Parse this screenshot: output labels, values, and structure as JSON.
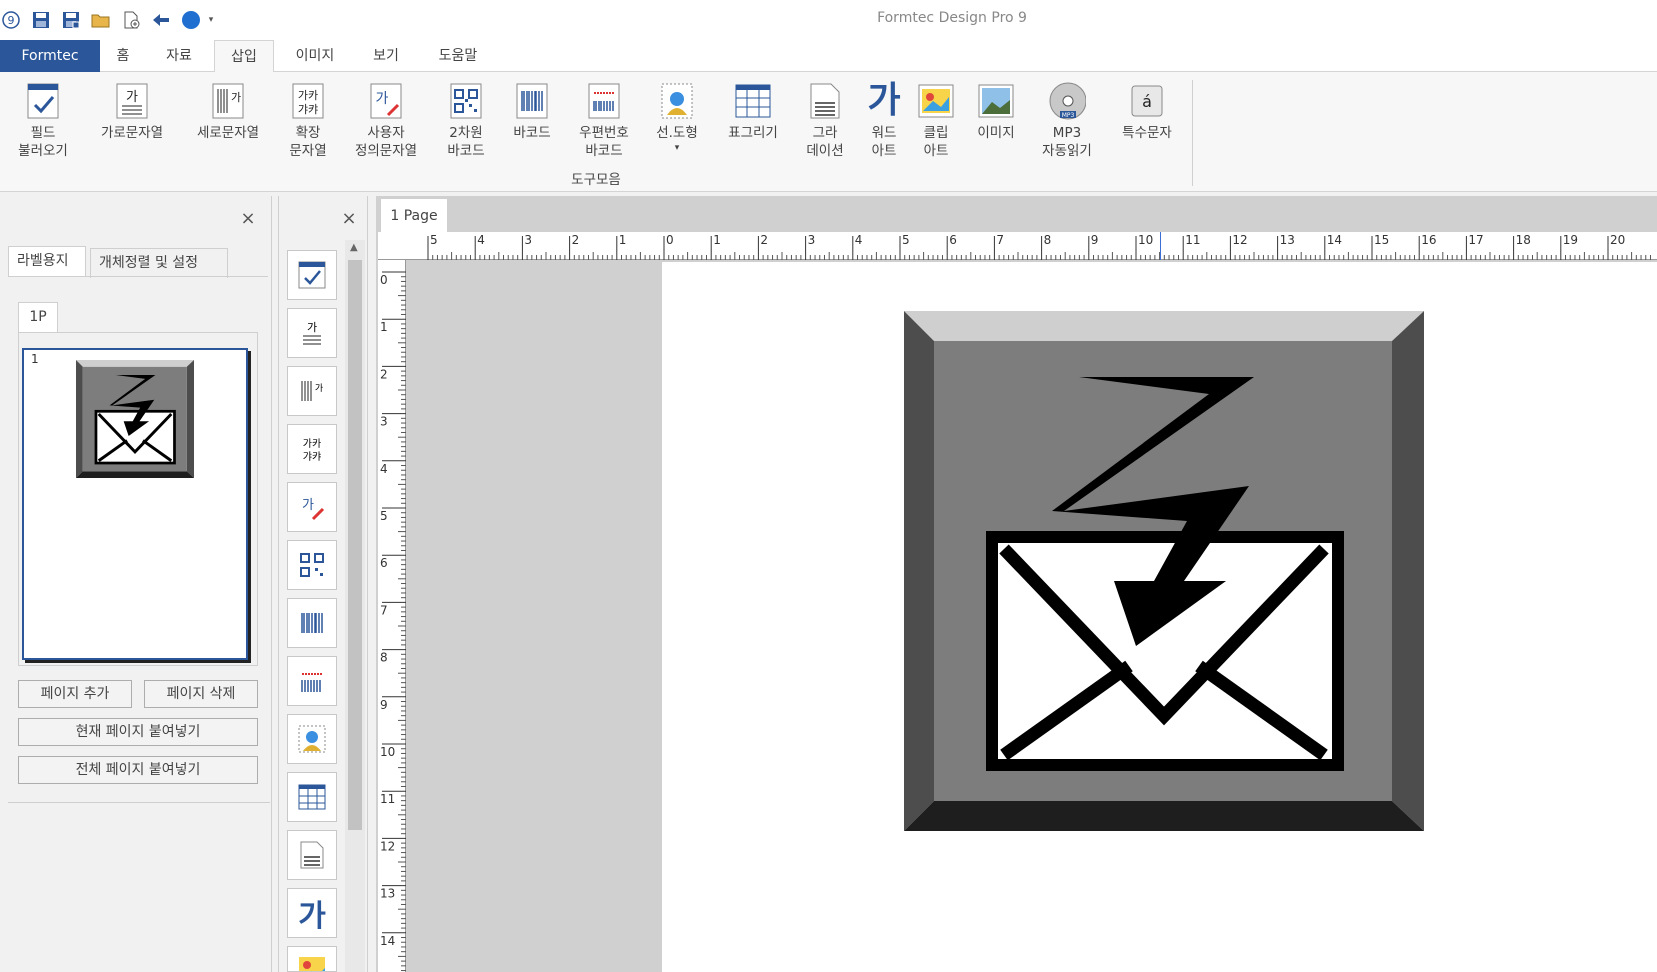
{
  "window": {
    "title": "Formtec Design Pro 9"
  },
  "menu": {
    "file_label": "Formtec",
    "tabs": [
      "홈",
      "자료",
      "삽입",
      "이미지",
      "보기",
      "도움말"
    ],
    "active_tab": "삽입"
  },
  "ribbon": {
    "items": [
      {
        "line1": "필드",
        "line2": "불러오기",
        "icon": "field-load-icon"
      },
      {
        "line1": "가로문자열",
        "line2": "",
        "icon": "horizontal-text-icon"
      },
      {
        "line1": "세로문자열",
        "line2": "",
        "icon": "vertical-text-icon"
      },
      {
        "line1": "확장",
        "line2": "문자열",
        "icon": "extended-text-icon"
      },
      {
        "line1": "사용자",
        "line2": "정의문자열",
        "icon": "custom-text-icon"
      },
      {
        "line1": "2차원",
        "line2": "바코드",
        "icon": "qr-code-icon"
      },
      {
        "line1": "바코드",
        "line2": "",
        "icon": "barcode-icon"
      },
      {
        "line1": "우편번호",
        "line2": "바코드",
        "icon": "postal-barcode-icon"
      },
      {
        "line1": "선.도형",
        "line2": "▾",
        "icon": "shape-icon"
      },
      {
        "line1": "표그리기",
        "line2": "",
        "icon": "table-icon"
      },
      {
        "line1": "그라",
        "line2": "데이션",
        "icon": "gradation-icon"
      },
      {
        "line1": "워드",
        "line2": "아트",
        "icon": "wordart-icon"
      },
      {
        "line1": "클립",
        "line2": "아트",
        "icon": "clipart-icon"
      },
      {
        "line1": "이미지",
        "line2": "",
        "icon": "image-icon"
      },
      {
        "line1": "MP3",
        "line2": "자동읽기",
        "icon": "mp3-icon"
      },
      {
        "line1": "특수문자",
        "line2": "",
        "icon": "special-char-icon"
      }
    ],
    "group_label": "도구모음"
  },
  "left_panel": {
    "tabs": [
      "라벨용지",
      "개체정렬 및 설정"
    ],
    "page_tab": "1P",
    "thumb_number": "1",
    "add_page": "페이지 추가",
    "delete_page": "페이지 삭제",
    "paste_current": "현재 페이지 붙여넣기",
    "paste_all": "전체 페이지 붙여넣기"
  },
  "canvas": {
    "page_tab": "1 Page",
    "hruler": [
      "5",
      "4",
      "3",
      "2",
      "1",
      "0",
      "1",
      "2",
      "3",
      "4",
      "5",
      "6",
      "7",
      "8",
      "9",
      "10",
      "11",
      "12",
      "13",
      "14",
      "15",
      "16",
      "17",
      "18",
      "19",
      "20"
    ],
    "vruler": [
      "0",
      "1",
      "2",
      "3",
      "4",
      "5",
      "6",
      "7",
      "8",
      "9",
      "10",
      "11",
      "12",
      "13",
      "14"
    ]
  },
  "colors": {
    "accent": "#2b579a",
    "icon_blue": "#2b579a"
  }
}
